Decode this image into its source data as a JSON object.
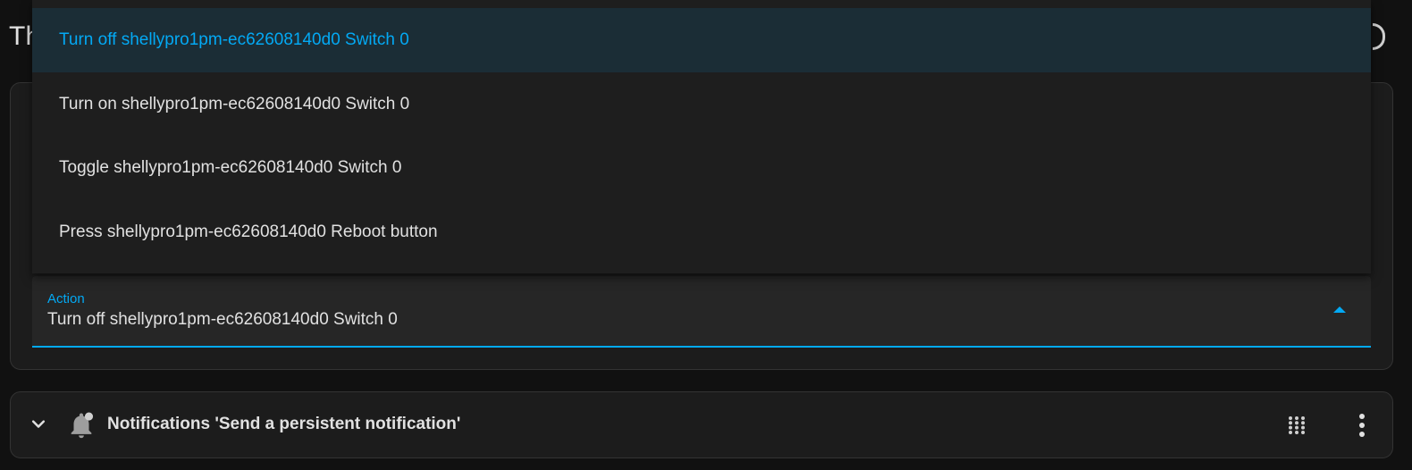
{
  "page": {
    "heading_fragment": "Th"
  },
  "action_select": {
    "label": "Action",
    "value": "Turn off shellypro1pm-ec62608140d0 Switch 0"
  },
  "dropdown": {
    "options": [
      {
        "label": "Turn off shellypro1pm-ec62608140d0 Switch 0",
        "selected": true
      },
      {
        "label": "Turn on shellypro1pm-ec62608140d0 Switch 0",
        "selected": false
      },
      {
        "label": "Toggle shellypro1pm-ec62608140d0 Switch 0",
        "selected": false
      },
      {
        "label": "Press shellypro1pm-ec62608140d0 Reboot button",
        "selected": false
      }
    ]
  },
  "notification_action": {
    "title": "Notifications 'Send a persistent notification'",
    "icons": {
      "expand": "chevron-down-icon",
      "type": "bell-badge-icon",
      "drag": "drag-handle-icon",
      "menu": "dots-vertical-icon"
    }
  },
  "colors": {
    "accent": "#03a9f4",
    "background": "#111111",
    "card": "#1c1c1c",
    "selected_item_bg": "#1b2d36"
  }
}
